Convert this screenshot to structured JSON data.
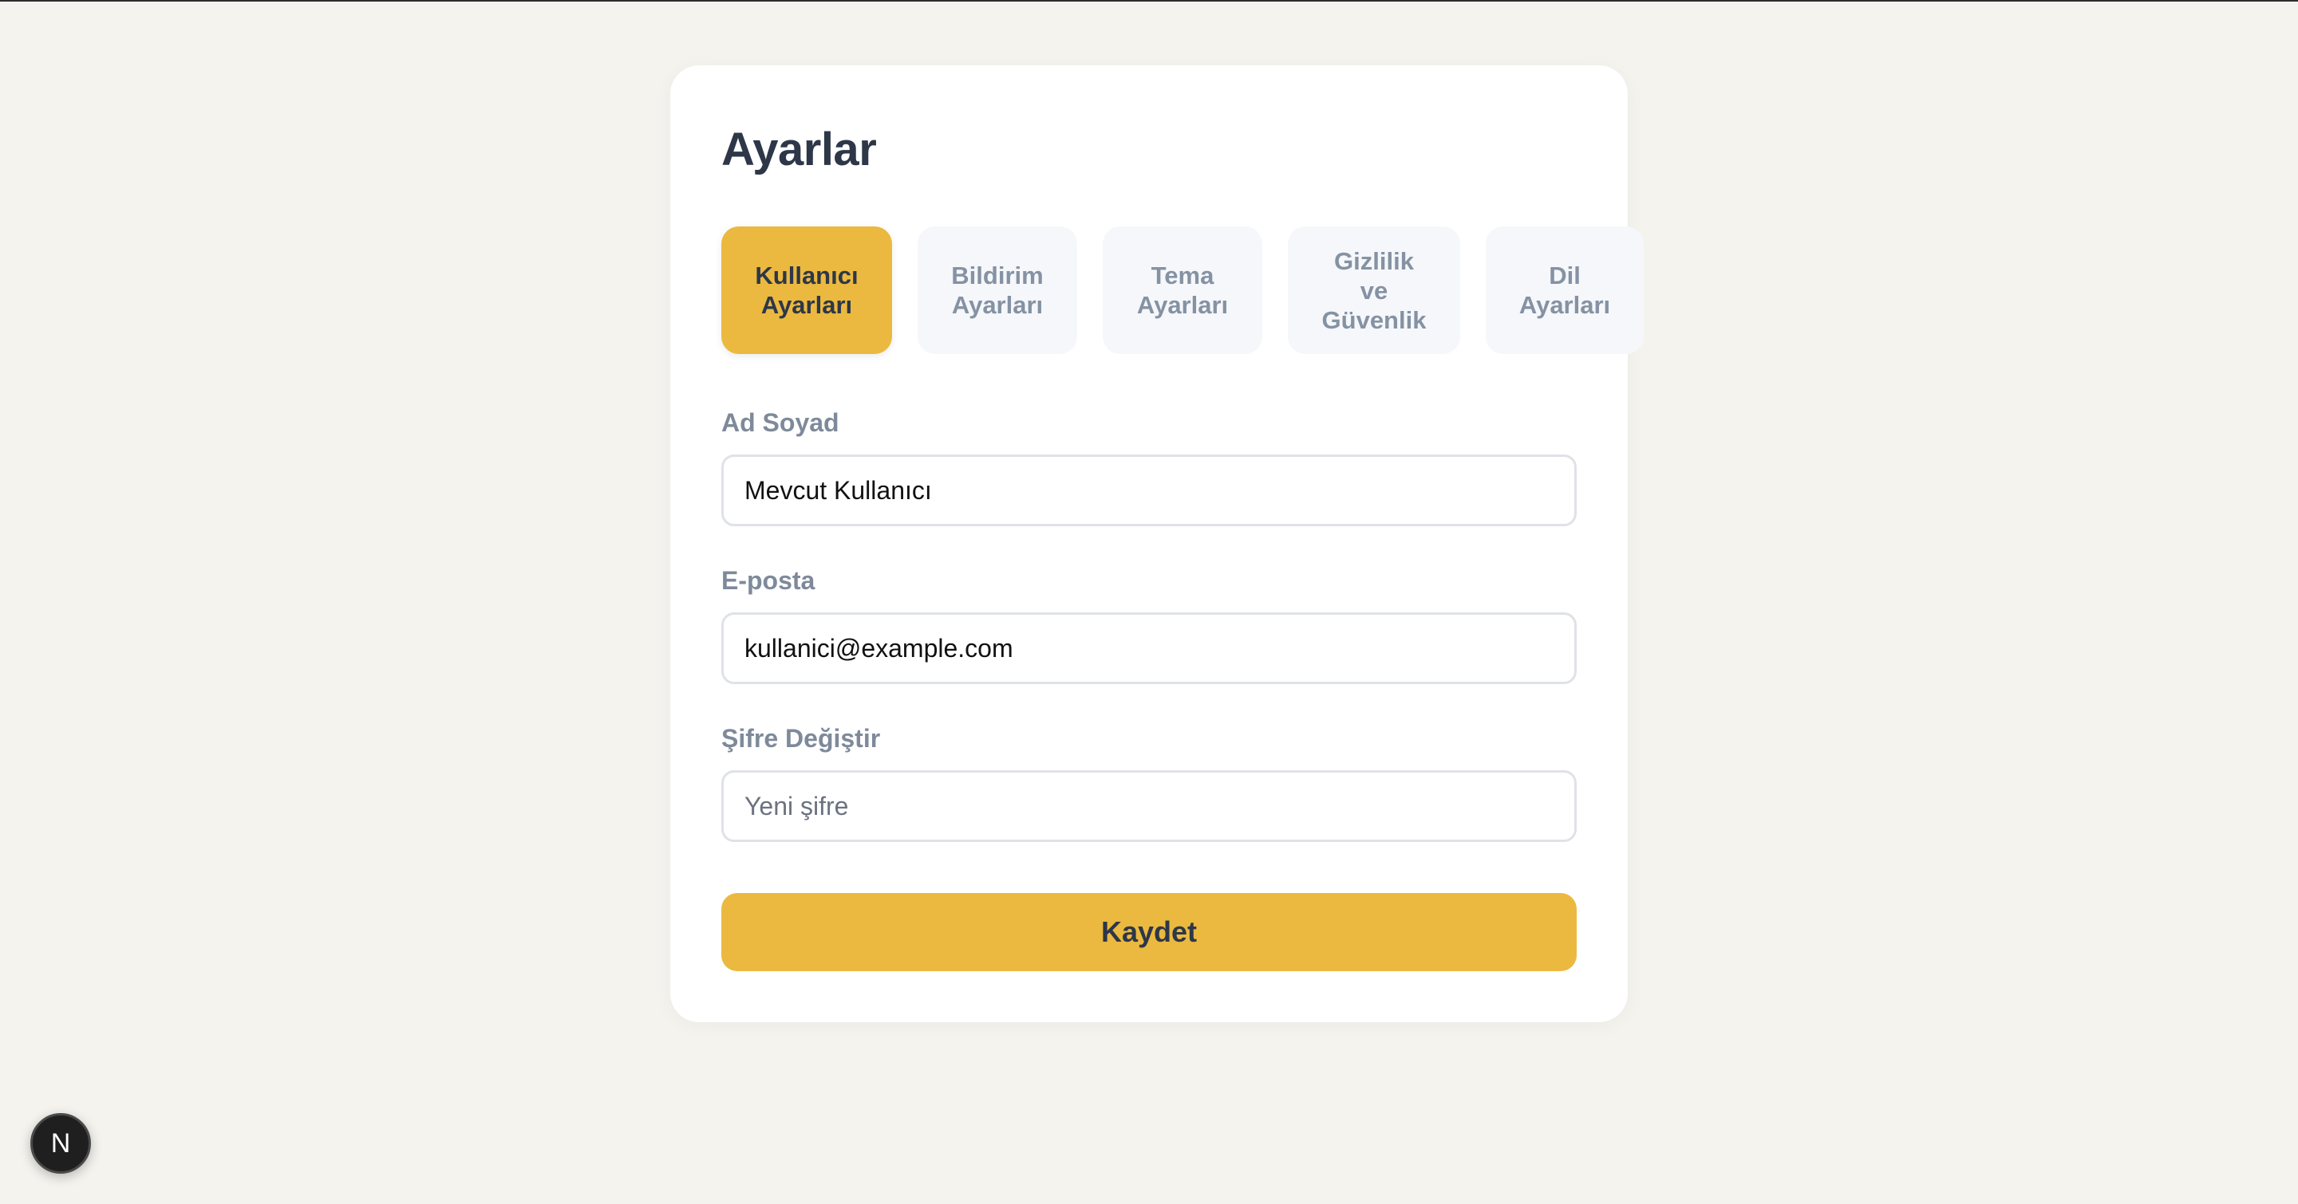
{
  "page": {
    "title": "Ayarlar"
  },
  "tabs": [
    {
      "label": "Kullanıcı\nAyarları",
      "active": true
    },
    {
      "label": "Bildirim\nAyarları",
      "active": false
    },
    {
      "label": "Tema\nAyarları",
      "active": false
    },
    {
      "label": "Gizlilik\nve\nGüvenlik",
      "active": false
    },
    {
      "label": "Dil\nAyarları",
      "active": false
    }
  ],
  "form": {
    "name": {
      "label": "Ad Soyad",
      "value": "Mevcut Kullanıcı"
    },
    "email": {
      "label": "E-posta",
      "value": "kullanici@example.com"
    },
    "password": {
      "label": "Şifre Değiştir",
      "placeholder": "Yeni şifre"
    },
    "save_label": "Kaydet"
  },
  "dev_badge": {
    "letter": "N"
  },
  "colors": {
    "accent": "#ebb93f",
    "background": "#f4f3ee",
    "card": "#ffffff",
    "title": "#2d3748",
    "muted": "#7e8a9a"
  }
}
